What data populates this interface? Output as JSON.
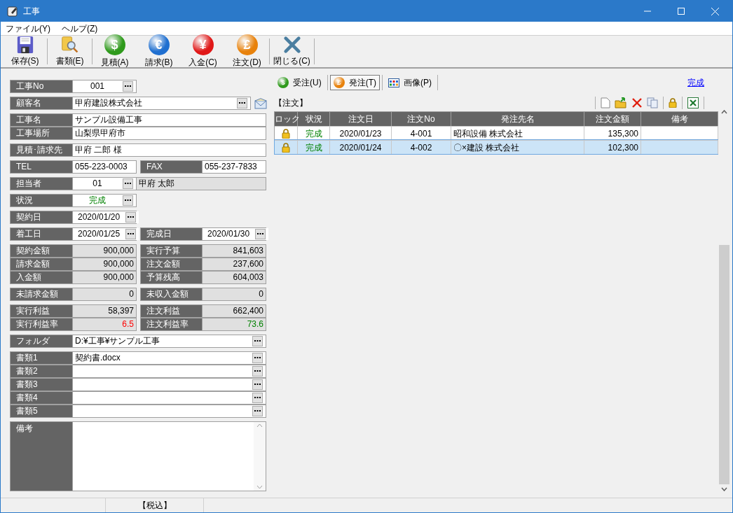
{
  "window": {
    "title": "工事"
  },
  "menu": [
    "ファイル(Y)",
    "ヘルプ(Z)"
  ],
  "toolbar": [
    {
      "label": "保存(S)",
      "kind": "save"
    },
    {
      "label": "書類(E)",
      "kind": "documents"
    },
    {
      "label": "見積(A)",
      "kind": "coin",
      "symbol": "$",
      "color": "#2f9a1c"
    },
    {
      "label": "請求(B)",
      "kind": "coin",
      "symbol": "€",
      "color": "#1f6fd0"
    },
    {
      "label": "入金(C)",
      "kind": "coin",
      "symbol": "¥",
      "color": "#e01818"
    },
    {
      "label": "注文(D)",
      "kind": "coin",
      "symbol": "£",
      "color": "#e8820c"
    },
    {
      "label": "閉じる(C)",
      "kind": "close"
    }
  ],
  "form": [
    {
      "rows": [
        {
          "fields": [
            {
              "label": "工事No",
              "value": "001",
              "kind": "code",
              "button": true
            }
          ]
        }
      ]
    },
    {
      "rows": [
        {
          "fields": [
            {
              "label": "顧客名",
              "value": "甲府建設株式会社",
              "kind": "text",
              "button": true,
              "mail": true
            }
          ]
        }
      ]
    },
    {
      "rows": [
        {
          "fields": [
            {
              "label": "工事名",
              "value": "サンプル設備工事",
              "kind": "text"
            }
          ]
        },
        {
          "fields": [
            {
              "label": "工事場所",
              "value": "山梨県甲府市",
              "kind": "text"
            }
          ]
        }
      ]
    },
    {
      "rows": [
        {
          "fields": [
            {
              "label": "見積･請求先",
              "value": "甲府  二郎  様",
              "kind": "text"
            }
          ]
        }
      ]
    },
    {
      "rows": [
        {
          "fields": [
            {
              "label": "TEL",
              "value": "055-223-0003",
              "kind": "text"
            },
            {
              "label": "FAX",
              "value": "055-237-7833",
              "kind": "text"
            }
          ]
        }
      ]
    },
    {
      "rows": [
        {
          "fields": [
            {
              "label": "担当者",
              "value": "01",
              "kind": "code",
              "button": true
            },
            {
              "value": "甲府  太郎",
              "kind": "readonly"
            }
          ]
        }
      ]
    },
    {
      "rows": [
        {
          "fields": [
            {
              "label": "状況",
              "value": "完成",
              "kind": "code",
              "button": true,
              "color": "#008000"
            }
          ]
        }
      ]
    },
    {
      "rows": [
        {
          "fields": [
            {
              "label": "契約日",
              "value": "2020/01/20",
              "kind": "code",
              "button": true
            }
          ]
        }
      ]
    },
    {
      "rows": [
        {
          "fields": [
            {
              "label": "着工日",
              "value": "2020/01/25",
              "kind": "code",
              "button": true
            },
            {
              "label": "完成日",
              "value": "2020/01/30",
              "kind": "code",
              "button": true
            }
          ]
        }
      ]
    },
    {
      "rows": [
        {
          "fields": [
            {
              "label": "契約金額",
              "value": "900,000",
              "kind": "amount"
            },
            {
              "label": "実行予算",
              "value": "841,603",
              "kind": "amount"
            }
          ]
        },
        {
          "fields": [
            {
              "label": "請求金額",
              "value": "900,000",
              "kind": "amount"
            },
            {
              "label": "注文金額",
              "value": "237,600",
              "kind": "amount"
            }
          ]
        },
        {
          "fields": [
            {
              "label": "入金額",
              "value": "900,000",
              "kind": "amount"
            },
            {
              "label": "予算残高",
              "value": "604,003",
              "kind": "amount"
            }
          ]
        }
      ]
    },
    {
      "rows": [
        {
          "fields": [
            {
              "label": "未請求金額",
              "value": "0",
              "kind": "amount"
            },
            {
              "label": "未収入金額",
              "value": "0",
              "kind": "amount"
            }
          ]
        }
      ]
    },
    {
      "rows": [
        {
          "fields": [
            {
              "label": "実行利益",
              "value": "58,397",
              "kind": "amount"
            },
            {
              "label": "注文利益",
              "value": "662,400",
              "kind": "amount"
            }
          ]
        },
        {
          "fields": [
            {
              "label": "実行利益率",
              "value": "6.5",
              "kind": "amount",
              "color": "#ff0000"
            },
            {
              "label": "注文利益率",
              "value": "73.6",
              "kind": "amount",
              "color": "#008000"
            }
          ]
        }
      ]
    },
    {
      "rows": [
        {
          "fields": [
            {
              "label": "フォルダ",
              "value": "D:¥工事¥サンプル工事",
              "kind": "text",
              "button": true
            }
          ]
        }
      ]
    },
    {
      "rows": [
        {
          "fields": [
            {
              "label": "書類1",
              "value": "契約書.docx",
              "kind": "text",
              "button": true
            }
          ]
        },
        {
          "fields": [
            {
              "label": "書類2",
              "kind": "text",
              "button": true
            }
          ]
        },
        {
          "fields": [
            {
              "label": "書類3",
              "kind": "text",
              "button": true
            }
          ]
        },
        {
          "fields": [
            {
              "label": "書類4",
              "kind": "text",
              "button": true
            }
          ]
        },
        {
          "fields": [
            {
              "label": "書類5",
              "kind": "text",
              "button": true
            }
          ]
        }
      ]
    },
    {
      "rows": [
        {
          "fields": [
            {
              "label": "備考",
              "kind": "memo"
            }
          ]
        }
      ]
    }
  ],
  "tabs": [
    {
      "label": "受注(U)",
      "kind": "coin",
      "symbol": "$",
      "color": "#2f9a1c",
      "selected": false
    },
    {
      "label": "発注(T)",
      "kind": "coin",
      "symbol": "£",
      "color": "#e8820c",
      "selected": true
    },
    {
      "label": "画像(P)",
      "kind": "grid",
      "selected": false
    }
  ],
  "status_link": "完成",
  "section_title": "【注文】",
  "table": {
    "columns": [
      "ロック",
      "状況",
      "注文日",
      "注文No",
      "発注先名",
      "注文金額",
      "備考"
    ],
    "rows": [
      {
        "locked": true,
        "status": "完成",
        "date": "2020/01/23",
        "no": "4-001",
        "supplier": "昭和設備  株式会社",
        "amount": "135,300",
        "selected": false
      },
      {
        "locked": true,
        "status": "完成",
        "date": "2020/01/24",
        "no": "4-002",
        "supplier": "〇×建設  株式会社",
        "amount": "102,300",
        "selected": true
      }
    ]
  },
  "status_bar": [
    "【税込】"
  ]
}
